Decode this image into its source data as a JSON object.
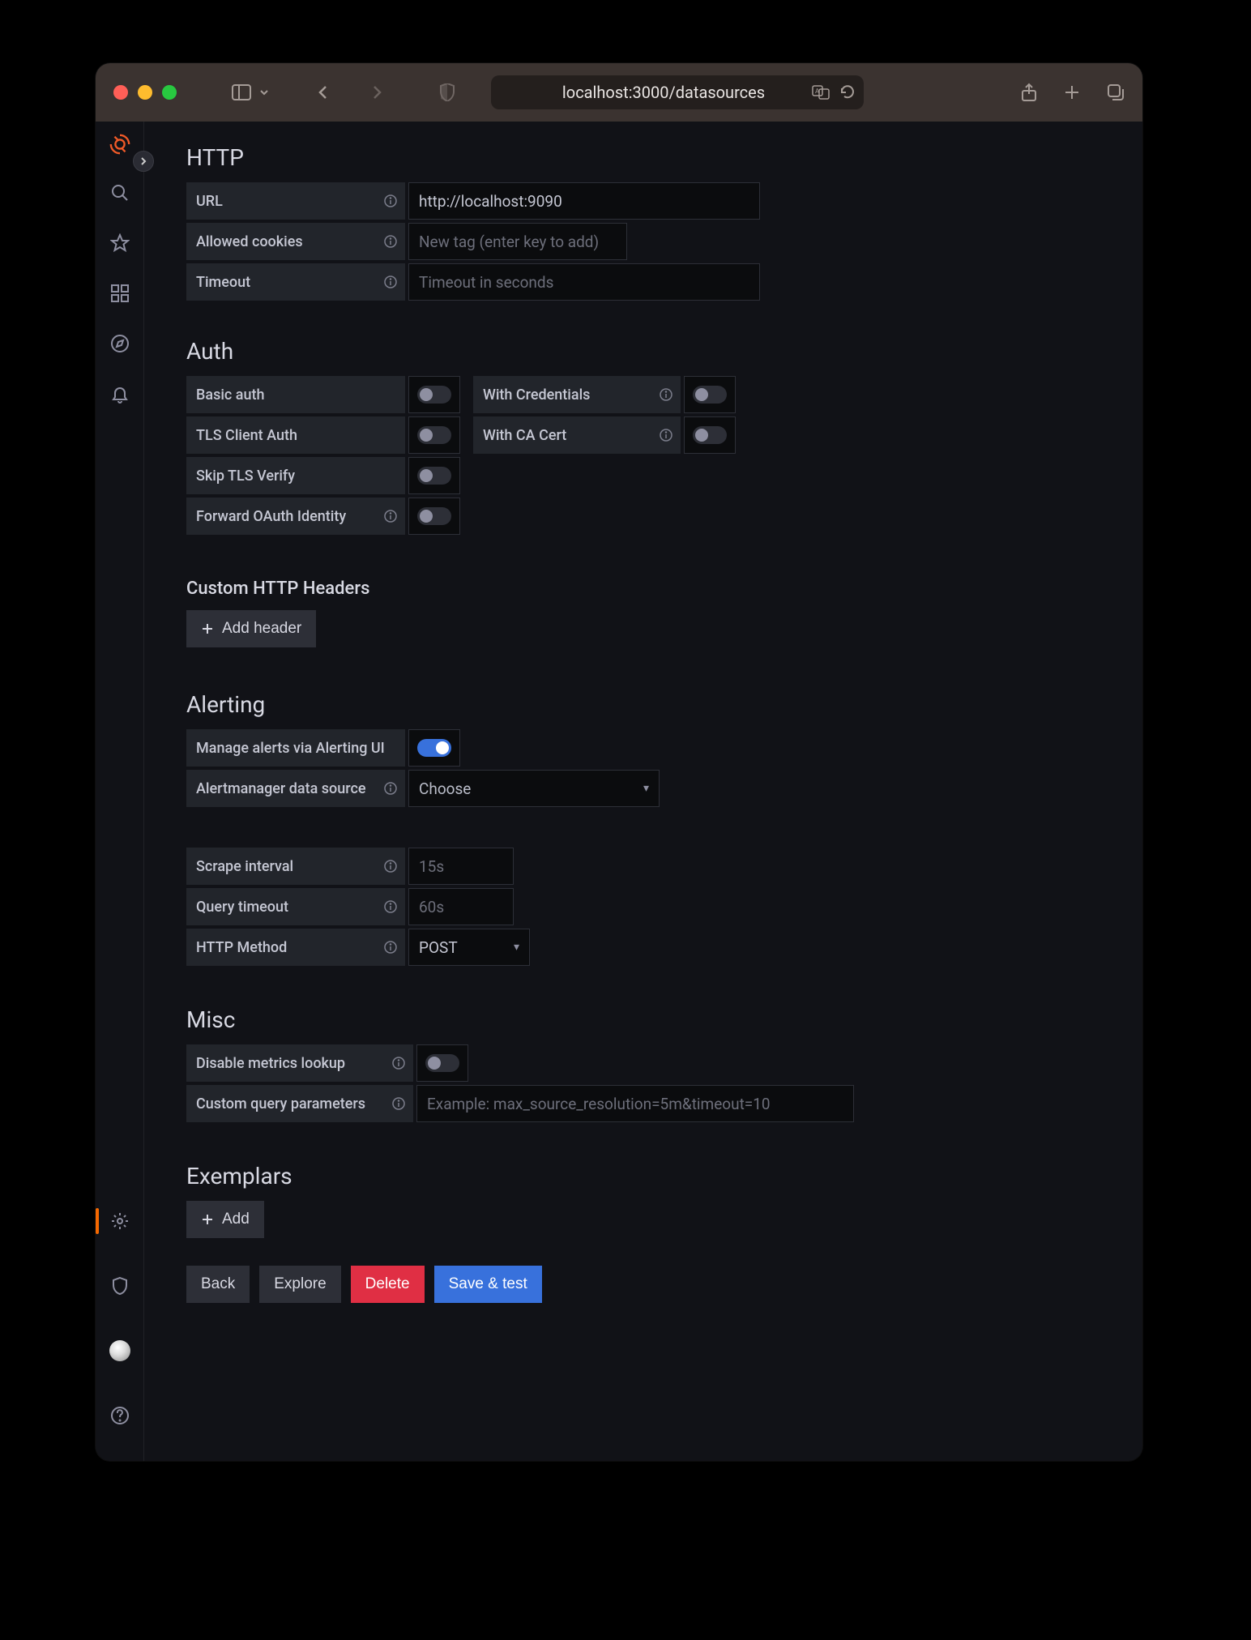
{
  "browser": {
    "url": "localhost:3000/datasources"
  },
  "sections": {
    "http": {
      "title": "HTTP",
      "url_label": "URL",
      "url_value": "http://localhost:9090",
      "cookies_label": "Allowed cookies",
      "cookies_placeholder": "New tag (enter key to add)",
      "timeout_label": "Timeout",
      "timeout_placeholder": "Timeout in seconds"
    },
    "auth": {
      "title": "Auth",
      "basic_auth": "Basic auth",
      "with_credentials": "With Credentials",
      "tls_client_auth": "TLS Client Auth",
      "with_ca_cert": "With CA Cert",
      "skip_tls_verify": "Skip TLS Verify",
      "forward_oauth": "Forward OAuth Identity"
    },
    "headers": {
      "title": "Custom HTTP Headers",
      "add_btn": "Add header"
    },
    "alerting": {
      "title": "Alerting",
      "manage_alerts": "Manage alerts via Alerting UI",
      "am_ds_label": "Alertmanager data source",
      "am_ds_placeholder": "Choose",
      "scrape_interval_label": "Scrape interval",
      "scrape_interval_placeholder": "15s",
      "query_timeout_label": "Query timeout",
      "query_timeout_placeholder": "60s",
      "http_method_label": "HTTP Method",
      "http_method_value": "POST"
    },
    "misc": {
      "title": "Misc",
      "disable_metrics": "Disable metrics lookup",
      "custom_query_label": "Custom query parameters",
      "custom_query_placeholder": "Example: max_source_resolution=5m&timeout=10"
    },
    "exemplars": {
      "title": "Exemplars",
      "add_btn": "Add"
    }
  },
  "footer": {
    "back": "Back",
    "explore": "Explore",
    "delete": "Delete",
    "save_test": "Save & test"
  }
}
